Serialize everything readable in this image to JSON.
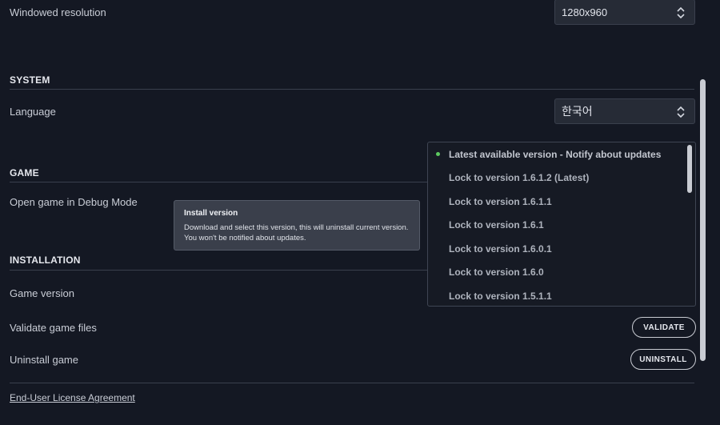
{
  "display": {
    "windowed_resolution_label": "Windowed resolution",
    "windowed_resolution_value": "1280x960"
  },
  "system": {
    "title": "SYSTEM",
    "language_label": "Language",
    "language_value": "한국어"
  },
  "game": {
    "title": "GAME",
    "debug_mode_label": "Open game in Debug Mode"
  },
  "tooltip": {
    "title": "Install version",
    "body": "Download and select this version, this will uninstall current version. You won't be notified about updates."
  },
  "version_dropdown": {
    "items": [
      "Latest available version - Notify about updates",
      "Lock to version 1.6.1.2 (Latest)",
      "Lock to version 1.6.1.1",
      "Lock to version 1.6.1",
      "Lock to version 1.6.0.1",
      "Lock to version 1.6.0",
      "Lock to version 1.5.1.1"
    ],
    "selected_index": 0
  },
  "installation": {
    "title": "INSTALLATION",
    "game_version_label": "Game version",
    "validate_label": "Validate game files",
    "validate_button": "VALIDATE",
    "uninstall_label": "Uninstall game",
    "uninstall_button": "UNINSTALL"
  },
  "eula_link": "End-User License Agreement",
  "colors": {
    "background": "#141823",
    "accent_dot": "#5cc95f"
  }
}
